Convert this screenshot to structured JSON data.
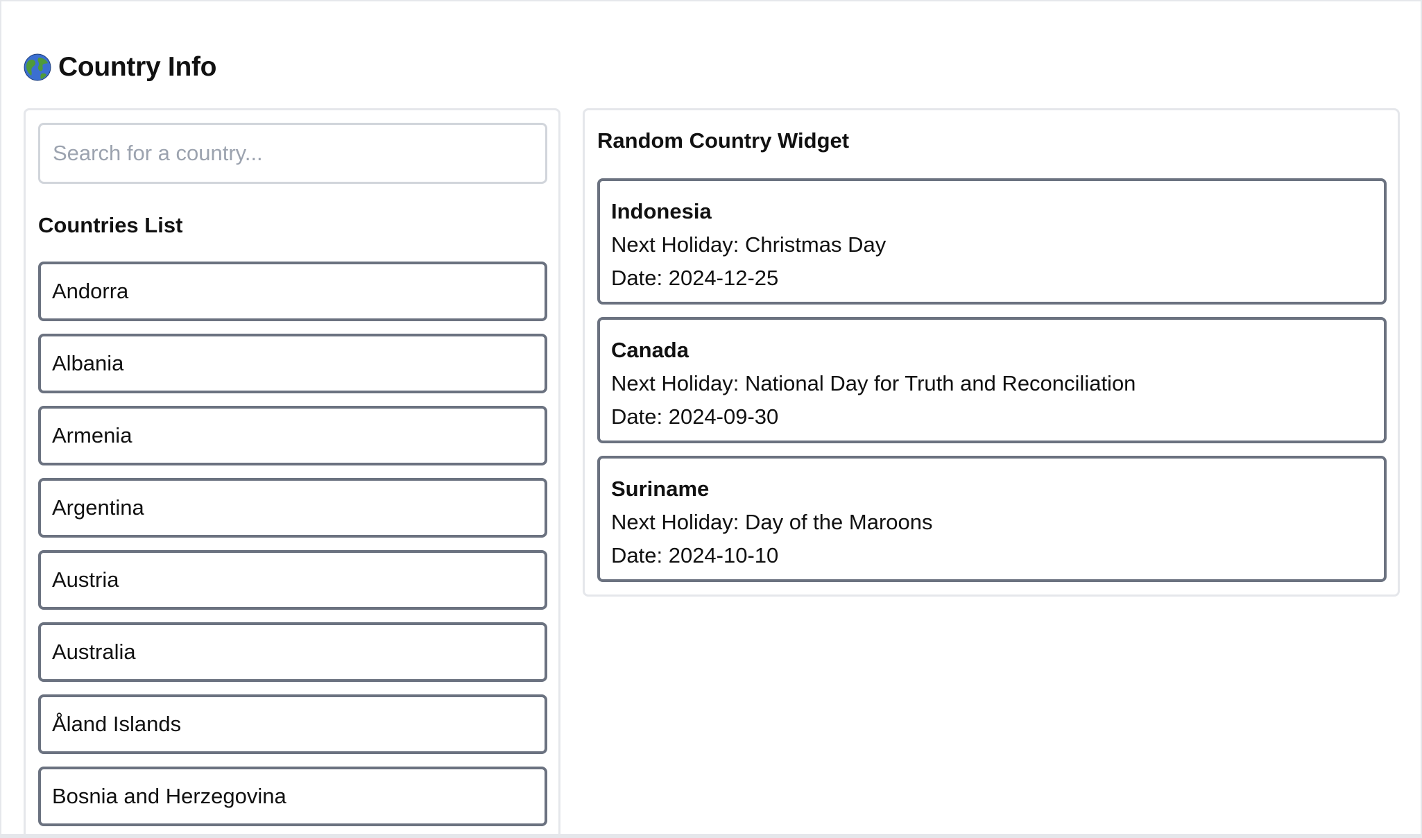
{
  "header": {
    "icon": "globe-icon",
    "title": "Country Info"
  },
  "search": {
    "placeholder": "Search for a country...",
    "value": ""
  },
  "countries_list": {
    "title": "Countries List",
    "items": [
      {
        "label": "Andorra"
      },
      {
        "label": "Albania"
      },
      {
        "label": "Armenia"
      },
      {
        "label": "Argentina"
      },
      {
        "label": "Austria"
      },
      {
        "label": "Australia"
      },
      {
        "label": "Åland Islands"
      },
      {
        "label": "Bosnia and Herzegovina"
      }
    ]
  },
  "widget": {
    "title": "Random Country Widget",
    "cards": [
      {
        "name": "Indonesia",
        "holiday_line": "Next Holiday: Christmas Day",
        "date_line": "Date: 2024-12-25"
      },
      {
        "name": "Canada",
        "holiday_line": "Next Holiday: National Day for Truth and Reconciliation",
        "date_line": "Date: 2024-09-30"
      },
      {
        "name": "Suriname",
        "holiday_line": "Next Holiday: Day of the Maroons",
        "date_line": "Date: 2024-10-10"
      }
    ]
  },
  "colors": {
    "panel_border": "#e5e7eb",
    "item_border": "#6b7280",
    "placeholder": "#9ca3af",
    "text": "#111111"
  }
}
